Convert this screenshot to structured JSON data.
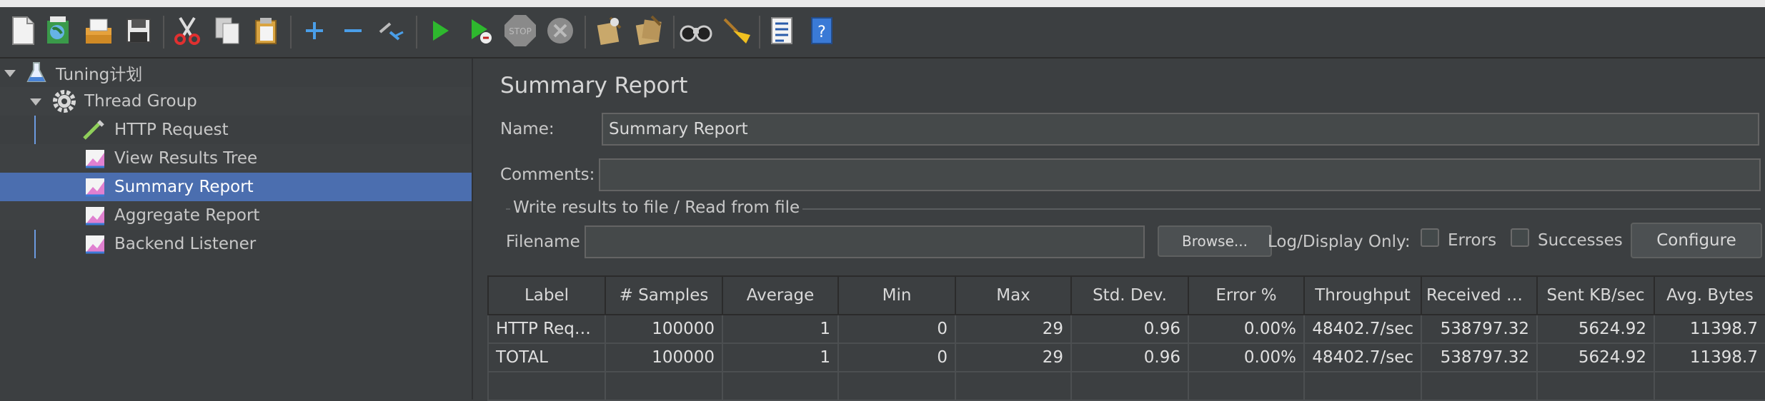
{
  "tree": {
    "items": [
      {
        "label": "Tuning计划",
        "icon": "test-plan-flask-icon"
      },
      {
        "label": "Thread Group",
        "icon": "gear-icon"
      },
      {
        "label": "HTTP Request",
        "icon": "pipette-icon"
      },
      {
        "label": "View Results Tree",
        "icon": "chart-icon"
      },
      {
        "label": "Summary Report",
        "icon": "chart-icon"
      },
      {
        "label": "Aggregate Report",
        "icon": "chart-icon"
      },
      {
        "label": "Backend Listener",
        "icon": "chart-icon"
      }
    ],
    "selected_index": 4
  },
  "panel": {
    "title": "Summary Report",
    "name_label": "Name:",
    "name_value": "Summary Report",
    "comments_label": "Comments:",
    "comments_value": "",
    "file_group_title": "Write results to file / Read from file",
    "filename_label": "Filename",
    "filename_value": "",
    "browse_label": "Browse...",
    "log_display_label": "Log/Display Only:",
    "errors_label": "Errors",
    "successes_label": "Successes",
    "configure_label": "Configure"
  },
  "table": {
    "headers": [
      "Label",
      "# Samples",
      "Average",
      "Min",
      "Max",
      "Std. Dev.",
      "Error %",
      "Throughput",
      "Received K...",
      "Sent KB/sec",
      "Avg. Bytes"
    ],
    "rows": [
      [
        "HTTP Requ...",
        "100000",
        "1",
        "0",
        "29",
        "0.96",
        "0.00%",
        "48402.7/sec",
        "538797.32",
        "5624.92",
        "11398.7"
      ],
      [
        "TOTAL",
        "100000",
        "1",
        "0",
        "29",
        "0.96",
        "0.00%",
        "48402.7/sec",
        "538797.32",
        "5624.92",
        "11398.7"
      ]
    ]
  },
  "colors": {
    "background": "#3c3f41",
    "selection": "#4b6eaf",
    "text": "#c8c8c8"
  },
  "toolbar": {
    "icons": [
      "new-icon",
      "templates-icon",
      "open-icon",
      "save-icon",
      "cut-icon",
      "copy-icon",
      "paste-icon",
      "expand-plus-icon",
      "collapse-minus-icon",
      "toggle-icon",
      "start-icon",
      "start-no-pauses-icon",
      "stop-icon",
      "shutdown-icon",
      "clear-icon",
      "clear-all-icon",
      "search-binoculars-icon",
      "reset-search-broom-icon",
      "function-helper-icon",
      "help-icon"
    ]
  }
}
